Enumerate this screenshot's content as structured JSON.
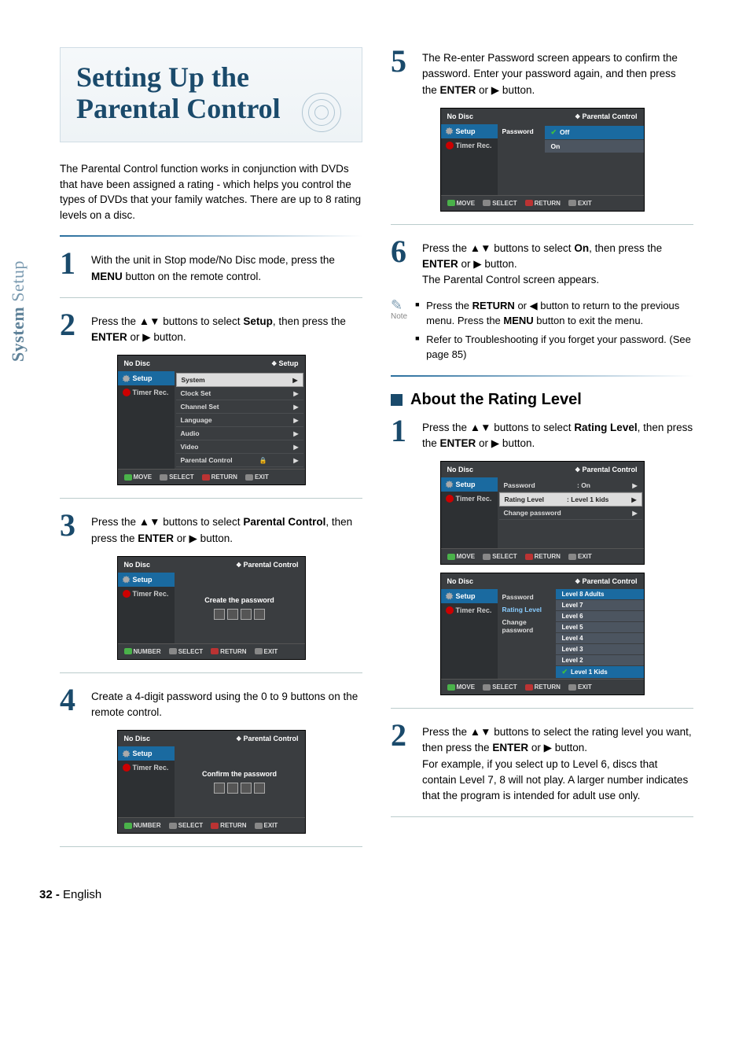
{
  "sideTab": {
    "part1": "System",
    "part2": "Setup"
  },
  "title": "Setting Up the Parental Control",
  "intro": "The Parental Control function works in conjunction with DVDs that have been assigned a rating - which helps you control the types of DVDs that your family watches. There are up to 8 rating levels on a disc.",
  "steps": {
    "s1": {
      "num": "1",
      "text_a": "With the unit in Stop mode/No Disc mode, press the ",
      "b1": "MENU",
      "text_b": " button on the remote control."
    },
    "s2": {
      "num": "2",
      "text_a": "Press the ▲▼ buttons to select ",
      "b1": "Setup",
      "text_b": ", then press the ",
      "b2": "ENTER",
      "text_c": " or ▶ button."
    },
    "s3": {
      "num": "3",
      "text_a": "Press the ▲▼ buttons to select ",
      "b1": "Parental Control",
      "text_b": ", then press the ",
      "b2": "ENTER",
      "text_c": " or ▶ button."
    },
    "s4": {
      "num": "4",
      "text": "Create a 4-digit password using the 0 to 9 buttons on the remote control."
    },
    "s5": {
      "num": "5",
      "text_a": "The Re-enter Password screen appears to confirm the password. Enter your password again, and then press the ",
      "b1": "ENTER",
      "text_b": " or ▶ button."
    },
    "s6": {
      "num": "6",
      "text_a": "Press the ▲▼ buttons to select ",
      "b1": "On",
      "text_b": ", then press the ",
      "b2": "ENTER",
      "text_c": " or ▶ button.",
      "tail": "The Parental Control screen appears."
    }
  },
  "noteLabel": "Note",
  "notes": {
    "n1a": "Press the ",
    "n1b": "RETURN",
    "n1c": " or ◀ button to return to the previous menu. Press the ",
    "n1d": "MENU",
    "n1e": " button to exit the menu.",
    "n2": "Refer to Troubleshooting if you forget your password. (See page 85)"
  },
  "subhead": "About the Rating Level",
  "rating": {
    "r1": {
      "num": "1",
      "text_a": "Press the ▲▼ buttons to select ",
      "b1": "Rating Level",
      "text_b": ", then press the ",
      "b2": "ENTER",
      "text_c": " or ▶ button."
    },
    "r2": {
      "num": "2",
      "text_a": "Press the ▲▼ buttons to select the rating level you want, then press the ",
      "b1": "ENTER",
      "text_b": " or ▶ button.",
      "tail": "For example, if you select up to Level 6, discs that contain Level 7, 8 will not play. A larger number indicates that the program is intended for adult use only."
    }
  },
  "osd": {
    "noDisc": "No Disc",
    "setup": "Setup",
    "timerRec": "Timer Rec.",
    "parentalControl": "Parental Control",
    "menu2": {
      "items": [
        "System",
        "Clock Set",
        "Channel Set",
        "Language",
        "Audio",
        "Video",
        "Parental Control"
      ]
    },
    "createPw": "Create the password",
    "confirmPw": "Confirm the password",
    "password": "Password",
    "off": "Off",
    "on": "On",
    "onVal": ": On",
    "ratingLevel": "Rating Level",
    "ratingVal": ": Level 1 kids",
    "changePw": "Change password",
    "levels": [
      "Level 8 Adults",
      "Level 7",
      "Level 6",
      "Level 5",
      "Level 4",
      "Level 3",
      "Level 2",
      "Level 1 Kids"
    ],
    "footMove": "MOVE",
    "footNumber": "NUMBER",
    "footSelect": "SELECT",
    "footReturn": "RETURN",
    "footExit": "EXIT"
  },
  "footer": {
    "pageNum": "32 - ",
    "lang": "English"
  }
}
